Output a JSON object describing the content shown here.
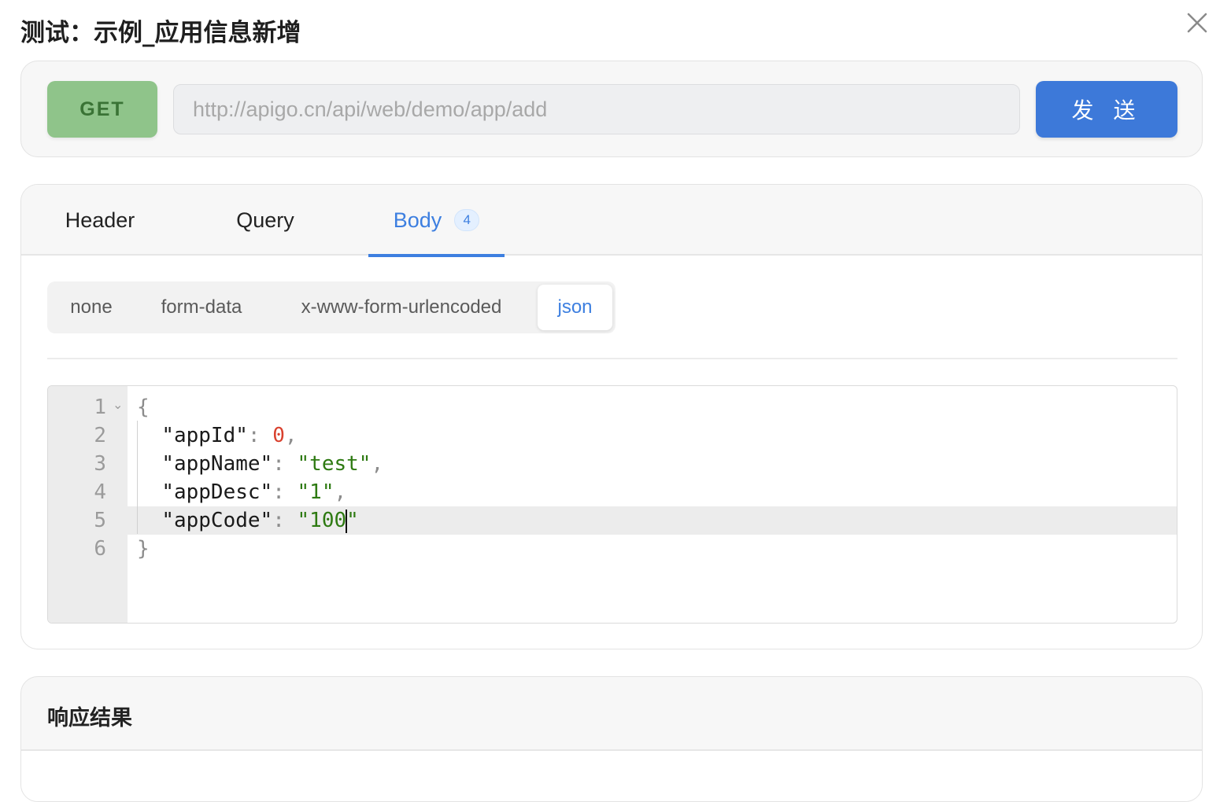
{
  "dialog": {
    "title": "测试：示例_应用信息新增"
  },
  "request": {
    "method": "GET",
    "url_placeholder": "http://apigo.cn/api/web/demo/app/add",
    "send_label": "发 送"
  },
  "tabs": [
    {
      "label": "Header",
      "active": false
    },
    {
      "label": "Query",
      "active": false
    },
    {
      "label": "Body",
      "active": true,
      "badge": "4"
    }
  ],
  "body_types": [
    {
      "label": "none",
      "active": false
    },
    {
      "label": "form-data",
      "active": false
    },
    {
      "label": "x-www-form-urlencoded",
      "active": false
    },
    {
      "label": "json",
      "active": true
    }
  ],
  "editor": {
    "line_numbers": [
      "1",
      "2",
      "3",
      "4",
      "5",
      "6"
    ],
    "active_line": 5,
    "lines": [
      {
        "open": "{"
      },
      {
        "key": "\"appId\"",
        "colon": ": ",
        "value": "0",
        "value_type": "number",
        "comma": ","
      },
      {
        "key": "\"appName\"",
        "colon": ": ",
        "value": "\"test\"",
        "value_type": "string",
        "comma": ","
      },
      {
        "key": "\"appDesc\"",
        "colon": ": ",
        "value": "\"1\"",
        "value_type": "string",
        "comma": ","
      },
      {
        "key": "\"appCode\"",
        "colon": ": ",
        "value_before_cursor": "\"100",
        "value_after_cursor": "\"",
        "value_type": "string",
        "comma": ""
      },
      {
        "close": "}"
      }
    ]
  },
  "response": {
    "title": "响应结果"
  },
  "colors": {
    "accent": "#3d7fe0",
    "method_bg": "#8fc48a",
    "send_bg": "#3d79d9",
    "number": "#d9412e",
    "string": "#2e7a12"
  }
}
